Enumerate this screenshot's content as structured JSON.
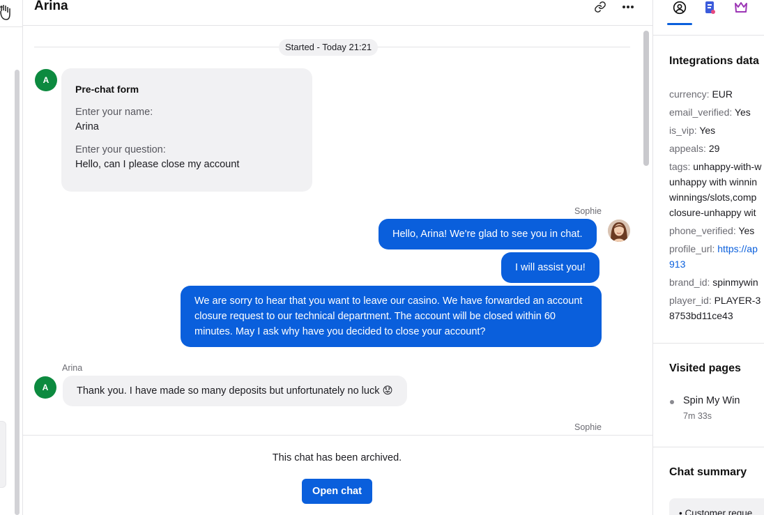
{
  "header": {
    "title": "Arina",
    "link_icon": "link-icon",
    "more_icon": "more-horizontal-icon"
  },
  "messages": {
    "started": "Started - Today 21:21",
    "prechat": {
      "avatar": "A",
      "title": "Pre-chat form",
      "name_label": "Enter your name:",
      "name_value": "Arina",
      "question_label": "Enter your question:",
      "question_value": "Hello, can I please close my account"
    },
    "agent_name": "Sophie",
    "agent_msg_1": "Hello, Arina! We're glad to see you in chat.",
    "agent_msg_2": "I will assist you!",
    "agent_msg_3": "We are sorry to hear that you want to leave our casino. We have forwarded an account closure request to our technical department. The account will be closed within 60 minutes. May I ask why have you decided to close your account?",
    "customer_name": "Arina",
    "customer_avatar": "A",
    "customer_msg_1": "Thank you. I have made so many deposits but unfortunately no luck 😟",
    "agent_name_2": "Sophie"
  },
  "archived": {
    "text": "This chat has been archived.",
    "button": "Open chat"
  },
  "right_panel": {
    "tabs": [
      "user-circle-icon",
      "document-icon",
      "crown-icon"
    ],
    "integrations_title": "Integrations data",
    "fields": [
      {
        "key": "currency:",
        "value": "EUR"
      },
      {
        "key": "email_verified:",
        "value": "Yes"
      },
      {
        "key": "is_vip:",
        "value": "Yes"
      },
      {
        "key": "appeals:",
        "value": "29"
      },
      {
        "key": "tags:",
        "value": "unhappy-with-w",
        "line2": "unhappy with winnin",
        "line3": "winnings/slots,comp",
        "line4": "closure-unhappy wit"
      },
      {
        "key": "phone_verified:",
        "value": "Yes"
      },
      {
        "key": "profile_url:",
        "value": "https://ap",
        "line2": "913"
      },
      {
        "key": "brand_id:",
        "value": "spinmywin"
      },
      {
        "key": "player_id:",
        "value": "PLAYER-3",
        "line2": "8753bd11ce43"
      }
    ],
    "visited_title": "Visited pages",
    "visited_page": "Spin My Win",
    "visited_time": "7m 33s",
    "summary_title": "Chat summary",
    "summary_snippet": "Customer reque"
  },
  "colors": {
    "accent": "#0a5fdc",
    "avatar_green": "#0c8a3f",
    "bubble_gray": "#f1f1f3"
  }
}
